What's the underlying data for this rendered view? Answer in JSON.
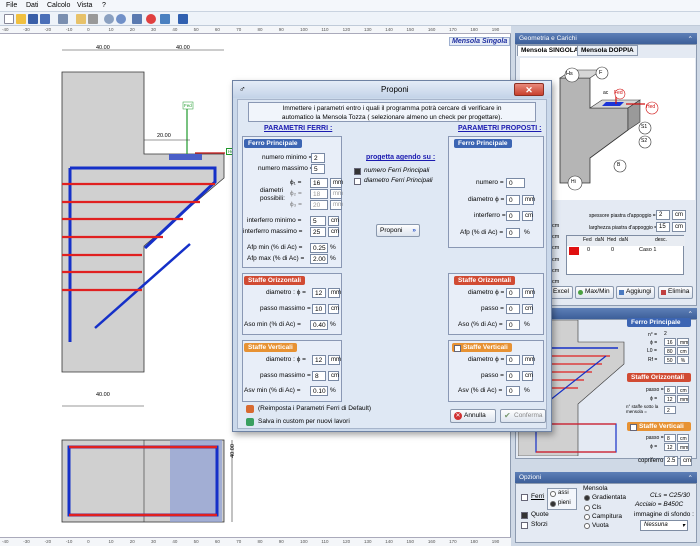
{
  "menu": {
    "file": "File",
    "dati": "Dati",
    "calcolo": "Calcolo",
    "vista": "Vista",
    "help": "?"
  },
  "canvas": {
    "title": "Mensola Singola",
    "dims": {
      "top_left": "40.00",
      "top_right": "40.00",
      "mid": "20.00",
      "bottom": "40.00",
      "side": "40.00"
    },
    "labels": {
      "fed": "Fed",
      "hed": "Hed"
    },
    "ruler_top": [
      "-40",
      "-30",
      "-20",
      "-10",
      "0",
      "10",
      "20",
      "30",
      "40",
      "50",
      "60",
      "70",
      "80",
      "90",
      "100",
      "110",
      "120",
      "130",
      "140",
      "150",
      "160",
      "170",
      "180",
      "190"
    ],
    "ruler_bottom": [
      "-40",
      "-30",
      "-20",
      "-10",
      "0",
      "10",
      "20",
      "30",
      "40",
      "50",
      "60",
      "70",
      "80",
      "90",
      "100",
      "110",
      "120",
      "130",
      "140",
      "150",
      "160",
      "170",
      "180",
      "190"
    ]
  },
  "dialog": {
    "title": "Proponi",
    "close": "✕",
    "intro": "Immettere i parametri entro i quali il programma potrà cercare di verificare in automatico la Mensola Tozza ( selezionare almeno un check per progettare).",
    "param_ferri": "PARAMETRI FERRI :",
    "param_proposti": "PARAMETRI PROPOSTI :",
    "ferro_principale": "Ferro Principale",
    "numero_minimo_lbl": "numero minimo =",
    "numero_minimo": "2",
    "numero_massimo_lbl": "numero massimo =",
    "numero_massimo": "5",
    "diametri_lbl": "diametri possibili:",
    "phi1_lbl": "ϕ₁ =",
    "phi1": "16",
    "phi2_lbl": "ϕ₂ =",
    "phi2": "18",
    "phi3_lbl": "ϕ₃ =",
    "phi3": "20",
    "interferro_min_lbl": "interferro minimo =",
    "interferro_min": "5",
    "interferro_max_lbl": "interferro massimo =",
    "interferro_max": "25",
    "afp_min_lbl": "Afp min (% di Ac) =",
    "afp_min": "0.25",
    "afp_max_lbl": "Afp max (% di Ac) =",
    "afp_max": "2.00",
    "unit_mm": "mm",
    "unit_cm": "cm",
    "unit_pct": "%",
    "progetta_lbl": "progetta agendo su :",
    "opt_numero": "numero Ferri Principali",
    "opt_diametro": "diametro Ferri Principali",
    "proponi_btn": "Proponi",
    "p_ferro_principale": "Ferro Principale",
    "p_numero_lbl": "numero =",
    "p_numero": "0",
    "p_diametro_lbl": "diametro ϕ =",
    "p_diametro": "0",
    "p_interferro_lbl": "interferro =",
    "p_interferro": "0",
    "p_afp_lbl": "Afp (% di Ac) =",
    "p_afp": "0",
    "staffe_orizz": "Staffe Orizzontali",
    "so_diam_lbl": "diametro : ϕ =",
    "so_diam": "12",
    "so_passo_lbl": "passo massimo =",
    "so_passo": "10",
    "so_aso_lbl": "Aso min (% di Ac) =",
    "so_aso": "0.40",
    "p_so_diam_lbl": "diametro ϕ =",
    "p_so_diam": "0",
    "p_so_passo_lbl": "passo =",
    "p_so_passo": "0",
    "p_so_aso_lbl": "Aso (% di Ac) =",
    "p_so_aso": "0",
    "staffe_vert": "Staffe Verticali",
    "sv_diam_lbl": "diametro : ϕ =",
    "sv_diam": "12",
    "sv_passo_lbl": "passo massimo =",
    "sv_passo": "8",
    "sv_asv_lbl": "Asv min (% di Ac) =",
    "sv_asv": "0.10",
    "p_sv_diam_lbl": "diametro ϕ =",
    "p_sv_diam": "0",
    "p_sv_passo_lbl": "passo =",
    "p_sv_passo": "0",
    "p_sv_asv_lbl": "Asv (% di Ac) =",
    "p_sv_asv": "0",
    "reimposta": "(Reimposta i Parametri Ferri di Default)",
    "salva": "Salva in custom per nuovi lavori",
    "annulla": "Annulla",
    "conferma": "Conferma"
  },
  "right": {
    "geometria": "Geometria e Carichi",
    "tab_singola": "Mensola SINGOLA",
    "tab_doppia": "Mensola DOPPIA",
    "diag": {
      "hs": "Hs",
      "f": "F",
      "ac": "ac",
      "fed": "Fed",
      "hed": "Hed",
      "s1": "S1",
      "s2": "S2",
      "b": "B",
      "hi": "Hi"
    },
    "spessore_lbl": "spessore piastra d'appoggio =",
    "spessore": "2",
    "larghezza_lbl": "larghezza piastra d'appoggio =",
    "larghezza": "15",
    "unit_cm": "cm",
    "table_headers": [
      "Fed",
      "daN",
      "Hed",
      "daN",
      "desc."
    ],
    "table_row": [
      "0",
      "0",
      "Caso 1"
    ],
    "btn_excel": "da Excel",
    "btn_maxmin": "Max/Min",
    "btn_aggiungi": "Aggiungi",
    "btn_elimina": "Elimina",
    "fp_title": "Ferro Principale",
    "fp_n": "n° =",
    "fp_n_val": "2",
    "fp_phi": "ϕ =",
    "fp_phi_val": "16",
    "fp_l0": "L0 =",
    "fp_l0_val": "80",
    "fp_rf": "Rf =",
    "fp_rf_val": "50",
    "so_title": "Staffe Orizzontali",
    "so_passo": "passo =",
    "so_passo_val": "8",
    "so_phi": "ϕ =",
    "so_phi_val": "12",
    "so_n": "n° staffe sotto la mensola =",
    "so_n_val": "2",
    "sv_title": "Staffe Verticali",
    "sv_passo": "passo =",
    "sv_passo_val": "8",
    "sv_phi": "ϕ =",
    "sv_phi_val": "12",
    "copriferro": "copriferro =",
    "copriferro_val": "2.5",
    "rl": "Rl",
    "opzioni": "Opzioni",
    "mensola": "Mensola",
    "ferri": "Ferri",
    "assi": "assi",
    "pieni": "pieni",
    "gradientata": "Gradientata",
    "cls": "Cls",
    "campitura": "Campitura",
    "vuota": "Vuota",
    "quote": "Quote",
    "sforzi": "Sforzi",
    "cls_val": "CLs = C25/30",
    "acciaio_val": "Acciaio = B450C",
    "immagine": "immagine di sfondo :",
    "nessuna": "Nessuna",
    "cm_rows": [
      "cm",
      "cm",
      "cm",
      "cm",
      "cm",
      "cm"
    ]
  }
}
